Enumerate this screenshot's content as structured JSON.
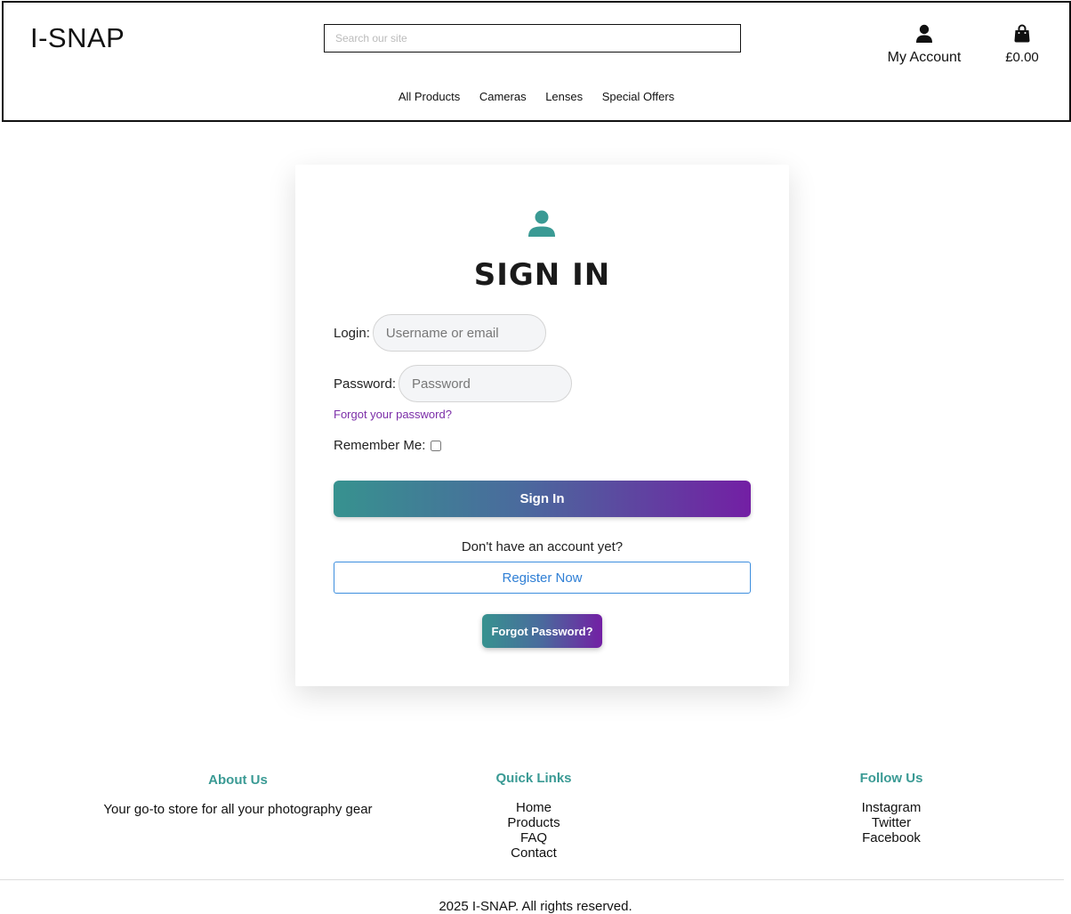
{
  "header": {
    "logo": "I-SNAP",
    "search_placeholder": "Search our site",
    "account_label": "My Account",
    "cart_total": "£0.00",
    "nav": [
      "All Products",
      "Cameras",
      "Lenses",
      "Special Offers"
    ],
    "icons": {
      "account": "user-icon",
      "cart": "shopping-bag-icon"
    }
  },
  "signin": {
    "icon": "user-icon",
    "title": "SIGN IN",
    "login_label": "Login:",
    "login_placeholder": "Username or email",
    "password_label": "Password:",
    "password_placeholder": "Password",
    "forgot_link": "Forgot your password?",
    "remember_label": "Remember Me:",
    "remember_checked": false,
    "submit": "Sign In",
    "no_account": "Don't have an account yet?",
    "register": "Register Now",
    "forgot_button": "Forgot Password?"
  },
  "footer": {
    "about": {
      "heading": "About Us",
      "text": "Your go-to store for all your photography gear"
    },
    "quick_links": {
      "heading": "Quick Links",
      "links": [
        "Home",
        "Products",
        "FAQ",
        "Contact"
      ]
    },
    "follow": {
      "heading": "Follow Us",
      "links": [
        "Instagram",
        "Twitter",
        "Facebook"
      ]
    },
    "copyright": "2025 I-SNAP. All rights reserved."
  },
  "colors": {
    "accent_teal": "#37928f",
    "accent_purple": "#731fa4",
    "link_purple": "#7b2ea8",
    "register_blue": "#2f7fd5",
    "footer_heading": "#3a9a94"
  }
}
